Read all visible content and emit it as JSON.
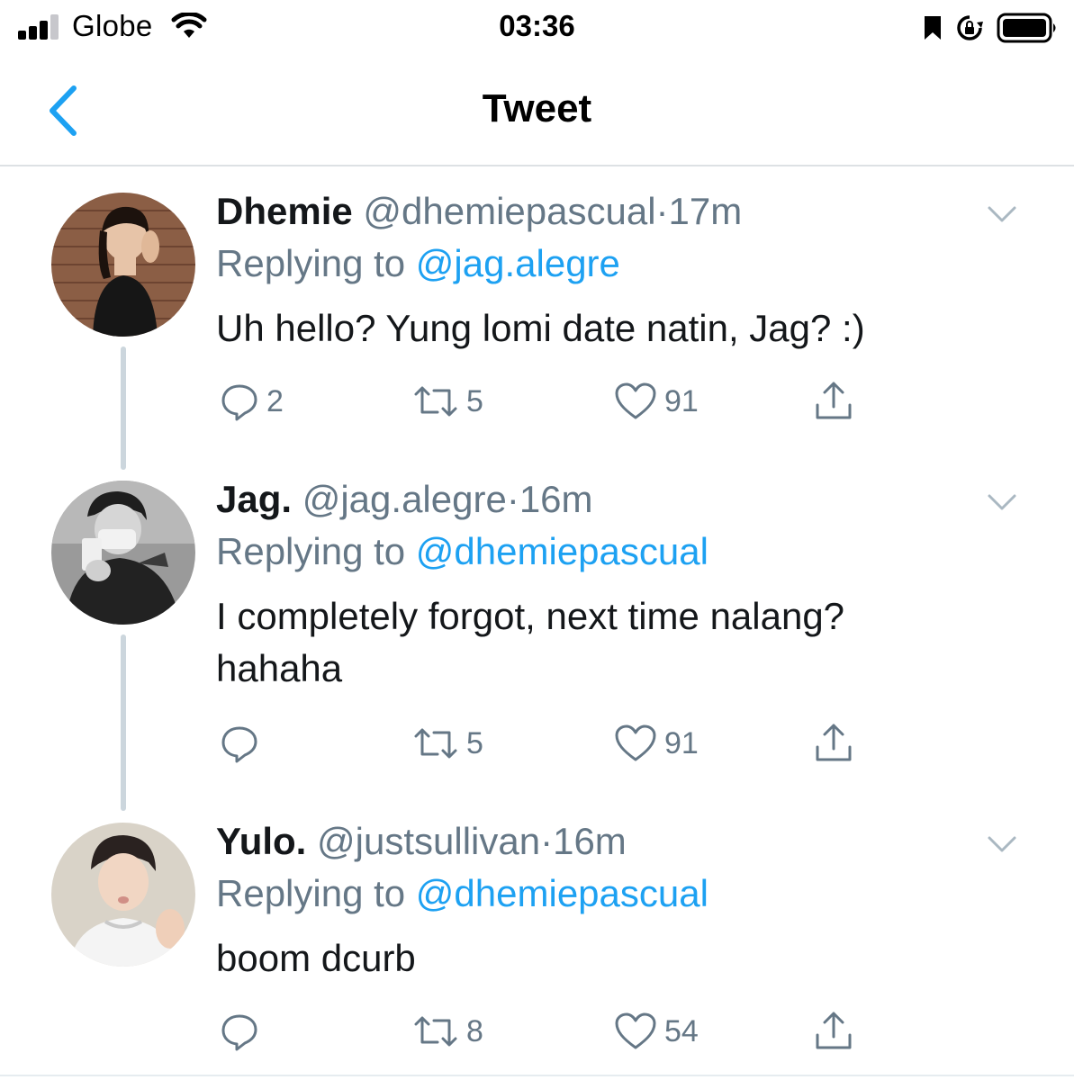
{
  "status_bar": {
    "carrier": "Globe",
    "time": "03:36"
  },
  "nav": {
    "title": "Tweet"
  },
  "colors": {
    "accent": "#1da1f2",
    "muted": "#657786",
    "thread_line": "#ccd6dd"
  },
  "tweets": [
    {
      "name": "Dhemie",
      "handle": "@dhemiepascual",
      "separator": "·",
      "time": "17m",
      "replying_prefix": "Replying to",
      "replying_to": "@jag.alegre",
      "text": "Uh hello? Yung lomi date natin, Jag? :)",
      "replies": "2",
      "retweets": "5",
      "likes": "91"
    },
    {
      "name": "Jag.",
      "handle": "@jag.alegre",
      "separator": "·",
      "time": "16m",
      "replying_prefix": "Replying to",
      "replying_to": "@dhemiepascual",
      "text_line1": "I completely forgot, next time nalang?",
      "text_line2": "hahaha",
      "replies": "",
      "retweets": "5",
      "likes": "91"
    },
    {
      "name": "Yulo.",
      "handle": "@justsullivan",
      "separator": "·",
      "time": "16m",
      "replying_prefix": "Replying to",
      "replying_to": "@dhemiepascual",
      "text": "boom dcurb",
      "replies": "",
      "retweets": "8",
      "likes": "54"
    }
  ],
  "icons": [
    "signal-icon",
    "wifi-icon",
    "bookmark-icon",
    "rotation-lock-icon",
    "battery-icon",
    "back-chevron-icon",
    "reply-icon",
    "retweet-icon",
    "like-icon",
    "share-icon",
    "caret-down-icon"
  ]
}
